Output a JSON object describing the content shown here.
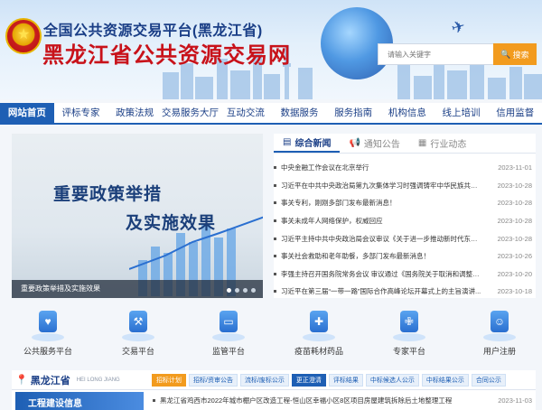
{
  "header": {
    "subtitle": "全国公共资源交易平台(黑龙江省)",
    "title": "黑龙江省公共资源交易网",
    "search_placeholder": "请输入关键字",
    "search_button": "搜索"
  },
  "nav": {
    "items": [
      {
        "label": "网站首页",
        "active": true
      },
      {
        "label": "评标专家"
      },
      {
        "label": "政策法规"
      },
      {
        "label": "交易服务大厅"
      },
      {
        "label": "互动交流"
      },
      {
        "label": "数据服务"
      },
      {
        "label": "服务指南"
      },
      {
        "label": "机构信息"
      },
      {
        "label": "线上培训"
      },
      {
        "label": "信用监督"
      }
    ]
  },
  "banner": {
    "headline_1": "重要政策举措",
    "headline_2": "及实施效果",
    "caption": "重要政策举措及实施效果",
    "slide_count": 4,
    "active_slide": 1
  },
  "news": {
    "tabs": [
      {
        "label": "综合新闻",
        "icon": "news-icon",
        "active": true
      },
      {
        "label": "通知公告",
        "icon": "megaphone-icon"
      },
      {
        "label": "行业动态",
        "icon": "trend-icon"
      }
    ],
    "items": [
      {
        "title": "中央金融工作会议在北京举行",
        "date": "2023-11-01"
      },
      {
        "title": "习近平在中共中央政治局第九次集体学习时强调铸牢中华民族共同...",
        "date": "2023-10-28"
      },
      {
        "title": "事关专利，刚刚多部门发布最新消息！",
        "date": "2023-10-28"
      },
      {
        "title": "事关未成年人网络保护，权威回应",
        "date": "2023-10-28"
      },
      {
        "title": "习近平主持中共中央政治局会议审议《关于进一步推动新时代东北全面...",
        "date": "2023-10-28"
      },
      {
        "title": "事关社会救助和老年助餐，多部门发布最新消息！",
        "date": "2023-10-26"
      },
      {
        "title": "李强主持召开国务院常务会议 审议通过《国务院关于取消和调整一系...",
        "date": "2023-10-20"
      },
      {
        "title": "习近平在第三届“一带一路”国际合作高峰论坛开幕式上的主旨演讲...",
        "date": "2023-10-18"
      }
    ]
  },
  "services": [
    {
      "label": "公共服务平台",
      "icon": "hand-heart-icon"
    },
    {
      "label": "交易平台",
      "icon": "gavel-icon"
    },
    {
      "label": "监管平台",
      "icon": "monitor-chart-icon"
    },
    {
      "label": "疫苗耗材药品",
      "icon": "syringe-icon"
    },
    {
      "label": "专家平台",
      "icon": "medical-kit-icon"
    },
    {
      "label": "用户注册",
      "icon": "user-register-icon"
    }
  ],
  "bottom": {
    "region": "黑龙江省",
    "region_en": "HEI LONG JIANG",
    "tabs": [
      {
        "label": "招标计划",
        "style": "hot"
      },
      {
        "label": "招标/资审公告"
      },
      {
        "label": "流标/废标公示"
      },
      {
        "label": "更正澄清",
        "style": "blue"
      },
      {
        "label": "评标结果"
      },
      {
        "label": "中标候选人公示"
      },
      {
        "label": "中标结果公示"
      },
      {
        "label": "合同公示"
      }
    ],
    "side_label": "工程建设信息",
    "row": {
      "title": "黑龙江省鸡西市2022年城市棚户区改造工程-恒山区幸福小区8区项目房屋建筑拆除后土地整理工程",
      "date": "2023-11-03"
    }
  }
}
